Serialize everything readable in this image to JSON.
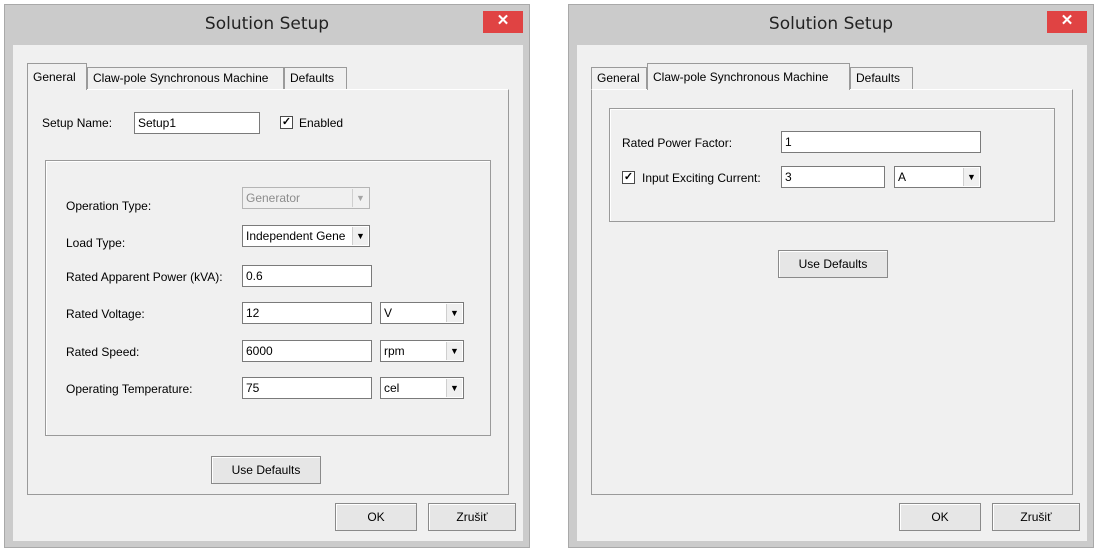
{
  "left": {
    "title": "Solution Setup",
    "close_glyph": "✕",
    "tabs": [
      "General",
      "Claw-pole Synchronous Machine",
      "Defaults"
    ],
    "setup_name_label": "Setup Name:",
    "setup_name_value": "Setup1",
    "enabled_label": "Enabled",
    "enabled_checked": true,
    "operation_type_label": "Operation Type:",
    "operation_type_value": "Generator",
    "load_type_label": "Load Type:",
    "load_type_value": "Independent Gene",
    "rated_apparent_power_label": "Rated Apparent Power (kVA):",
    "rated_apparent_power_value": "0.6",
    "rated_voltage_label": "Rated Voltage:",
    "rated_voltage_value": "12",
    "rated_voltage_unit": "V",
    "rated_speed_label": "Rated Speed:",
    "rated_speed_value": "6000",
    "rated_speed_unit": "rpm",
    "operating_temperature_label": "Operating Temperature:",
    "operating_temperature_value": "75",
    "operating_temperature_unit": "cel",
    "use_defaults_label": "Use Defaults",
    "ok_label": "OK",
    "cancel_label": "Zrušiť"
  },
  "right": {
    "title": "Solution Setup",
    "close_glyph": "✕",
    "tabs": [
      "General",
      "Claw-pole Synchronous Machine",
      "Defaults"
    ],
    "rated_power_factor_label": "Rated Power Factor:",
    "rated_power_factor_value": "1",
    "input_exciting_current_label": "Input Exciting Current:",
    "input_exciting_current_checked": true,
    "input_exciting_current_value": "3",
    "input_exciting_current_unit": "A",
    "use_defaults_label": "Use Defaults",
    "ok_label": "OK",
    "cancel_label": "Zrušiť"
  },
  "icons": {
    "close": "close-icon",
    "dropdown": "chevron-down-icon",
    "check": "checkmark-icon"
  },
  "colors": {
    "close_button": "#e04343",
    "window_frame": "#cbcbcb",
    "dialog_background": "#f0f0f0"
  }
}
